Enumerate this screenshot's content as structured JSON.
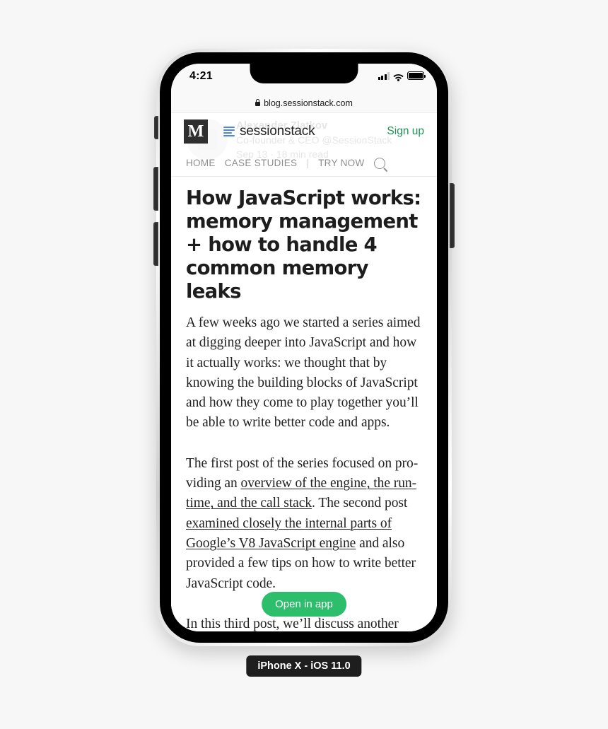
{
  "device": {
    "label": "iPhone X - iOS 11.0"
  },
  "status_bar": {
    "time": "4:21",
    "signal_icon": "cellular-signal-icon",
    "signal_bars_on": 3,
    "signal_bars_total": 4,
    "wifi_icon": "wifi-icon",
    "battery_icon": "battery-full-icon",
    "battery_level": 100
  },
  "browser": {
    "lock_icon": "lock-icon",
    "url": "blog.sessionstack.com"
  },
  "site_header": {
    "medium_logo": "M",
    "medium_logo_name": "medium-logo",
    "brand_mark_name": "sessionstack-logo",
    "brand_name": "sessionstack",
    "signup_label": "Sign up",
    "signup_color": "#1f9257"
  },
  "site_nav": {
    "items": [
      {
        "label": "HOME"
      },
      {
        "label": "CASE STUDIES"
      },
      {
        "separator": "|"
      },
      {
        "label": "TRY NOW"
      }
    ],
    "item_home": "HOME",
    "item_case_studies": "CASE STUDIES",
    "separator": "|",
    "item_try_now": "TRY NOW",
    "search_icon": "search-icon"
  },
  "ghost_author": {
    "name": "Alexander Zlatkov",
    "role": "Co-founder & CEO @SessionStack",
    "meta": "Sep 13 · 18 min read",
    "avatar_name": "author-avatar"
  },
  "article": {
    "title": "How JavaScript works: memory management + how to handle 4 common memory leaks",
    "paragraph_1": "A few weeks ago we started a series aimed at digging deeper into JavaScript and how it actually works: we thought that by knowing the building blocks of JavaScript and how they come to play together you’ll be able to write better code and apps.",
    "paragraph_2": {
      "part_1": "The first post of the series focused on pro­viding an ",
      "link_1": "overview of the engine, the run­time, and the call stack",
      "part_2": ". The second post ",
      "link_2": "examined closely the internal parts of Google’s V8 JavaScript engine",
      "part_3": " and also pro­vided a few tips on how to write better JavaScript code."
    },
    "paragraph_3": "In this third post, we’ll discuss another crit­ical topic that’s getting ever more neglected by developers due to the increasing matu­rity and complexity of programming lan­guages."
  },
  "floating_cta": {
    "label": "Open in app",
    "color": "#2cbe6b"
  }
}
